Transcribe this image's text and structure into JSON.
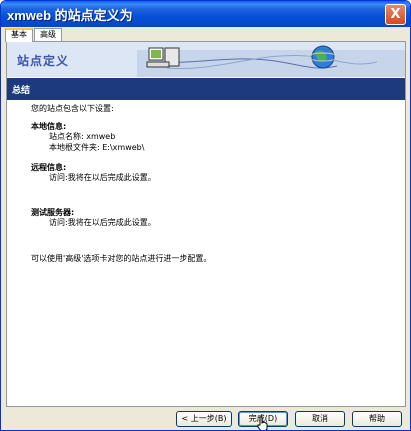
{
  "window": {
    "title": "xmweb 的站点定义为",
    "close_glyph": "X"
  },
  "tabs": [
    {
      "label": "基本",
      "active": true
    },
    {
      "label": "高级",
      "active": false
    }
  ],
  "banner": {
    "title": "站点定义"
  },
  "section": {
    "title": "总结",
    "intro": "您的站点包含以下设置:",
    "local": {
      "heading": "本地信息:",
      "site_name": "站点名称: xmweb",
      "root_folder": "本地根文件夹: E:\\xmweb\\"
    },
    "remote": {
      "heading": "远程信息:",
      "access": "访问:我将在以后完成此设置。"
    },
    "testing": {
      "heading": "测试服务器:",
      "access": "访问:我将在以后完成此设置。"
    },
    "footer_note": "可以使用'高级'选项卡对您的站点进行进一步配置。"
  },
  "buttons": {
    "back": "< 上一步(B)",
    "finish": "完成(D)",
    "cancel": "取消",
    "help": "帮助"
  },
  "colors": {
    "titlebar": "#0550d8",
    "section_bar": "#1d3a7f",
    "banner_bg": "#dce6f4",
    "banner_title": "#3b56a8"
  }
}
